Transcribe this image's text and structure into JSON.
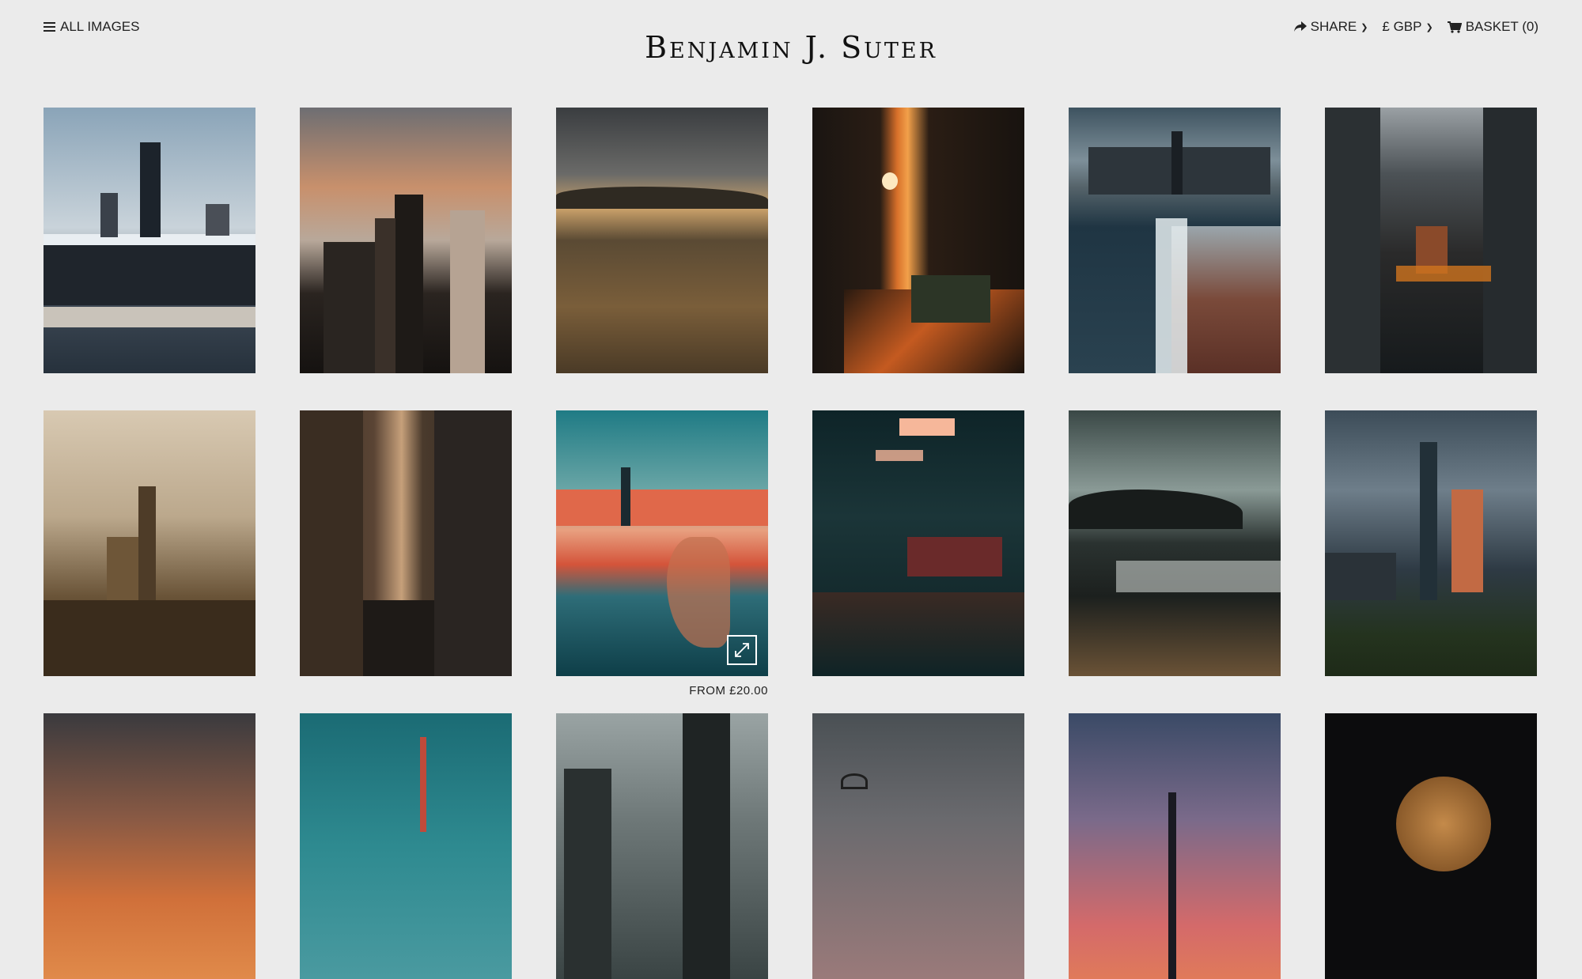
{
  "nav": {
    "all_images_label": "ALL IMAGES",
    "brand": "Benjamin J. Suter",
    "share_label": "SHARE",
    "currency_label": "£ GBP",
    "basket_label": "BASKET (0)"
  },
  "gallery": {
    "hover_price": "FROM £20.00",
    "photos": [
      {
        "subject": "chicago-skyline-pier"
      },
      {
        "subject": "skyscrapers-sunset"
      },
      {
        "subject": "prairie-storm"
      },
      {
        "subject": "sunset-train-canyon"
      },
      {
        "subject": "skyline-lake-waves"
      },
      {
        "subject": "elevated-train-tracks"
      },
      {
        "subject": "willis-tower-haze"
      },
      {
        "subject": "alley-sunlight"
      },
      {
        "subject": "skyline-moon-shore"
      },
      {
        "subject": "station-platform-train"
      },
      {
        "subject": "mountain-coast"
      },
      {
        "subject": "pavilion-skyline-night"
      },
      {
        "subject": "sunset-clouds"
      },
      {
        "subject": "spire-moon"
      },
      {
        "subject": "city-dusk-towers"
      },
      {
        "subject": "water-tower"
      },
      {
        "subject": "pink-sunset-skyline"
      },
      {
        "subject": "moon-stars"
      }
    ]
  },
  "colors": {
    "background": "#ebebeb",
    "text": "#222222"
  }
}
